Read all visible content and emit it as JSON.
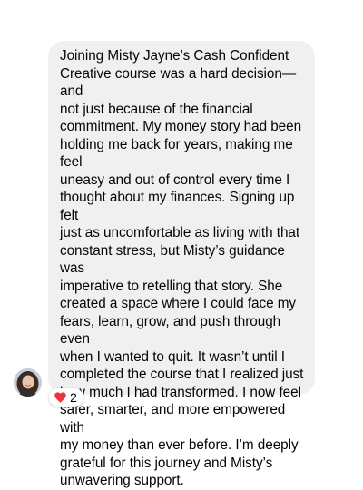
{
  "message": {
    "text": "Joining Misty Jayne’s Cash Confident\nCreative course was a hard decision— and\nnot just because of the financial\ncommitment. My money story had been\nholding me back for years, making me feel\nuneasy and out of control every time I\nthought about my finances. Signing up felt\njust as uncomfortable as living with that\nconstant stress, but Misty’s guidance was\nimperative to retelling that story. She\ncreated a space where I could face my\nfears, learn, grow, and push through even\nwhen I wanted to quit. It wasn’t until I\ncompleted the course that I realized just\nhow much I had transformed. I now feel\nsafer, smarter, and more empowered with\nmy money than ever before. I’m deeply\ngrateful for this journey and Misty’s\nunwavering support."
  },
  "reaction": {
    "icon": "heart-icon",
    "count": "2",
    "color": "#e8363f"
  },
  "avatar": {
    "icon": "user-avatar"
  },
  "colors": {
    "bubble": "#f0f0f0",
    "text": "#050505",
    "background": "#ffffff"
  }
}
